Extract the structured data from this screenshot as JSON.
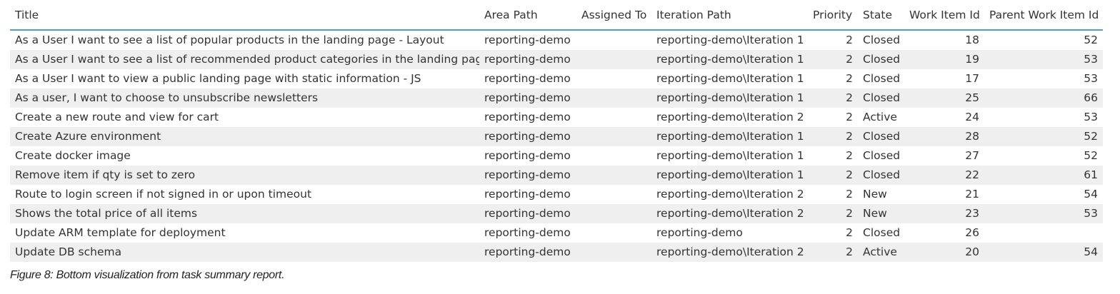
{
  "table": {
    "columns": [
      "Title",
      "Area Path",
      "Assigned To",
      "Iteration Path",
      "Priority",
      "State",
      "Work Item Id",
      "Parent Work Item Id"
    ],
    "rows": [
      [
        "As a User I want to see a list of popular products in the landing page - Layout",
        "reporting-demo",
        "",
        "reporting-demo\\Iteration 1",
        "2",
        "Closed",
        "18",
        "52"
      ],
      [
        "As a User I want to see a list of recommended product categories in the landing page",
        "reporting-demo",
        "",
        "reporting-demo\\Iteration 1",
        "2",
        "Closed",
        "19",
        "53"
      ],
      [
        "As a User I want to view a public landing page with static information - JS",
        "reporting-demo",
        "",
        "reporting-demo\\Iteration 1",
        "2",
        "Closed",
        "17",
        "53"
      ],
      [
        "As a user, I want to choose to unsubscribe newsletters",
        "reporting-demo",
        "",
        "reporting-demo\\Iteration 1",
        "2",
        "Closed",
        "25",
        "66"
      ],
      [
        "Create a new route and view for cart",
        "reporting-demo",
        "",
        "reporting-demo\\Iteration 2",
        "2",
        "Active",
        "24",
        "53"
      ],
      [
        "Create Azure environment",
        "reporting-demo",
        "",
        "reporting-demo\\Iteration 1",
        "2",
        "Closed",
        "28",
        "52"
      ],
      [
        "Create docker image",
        "reporting-demo",
        "",
        "reporting-demo\\Iteration 1",
        "2",
        "Closed",
        "27",
        "52"
      ],
      [
        "Remove item if qty is set to zero",
        "reporting-demo",
        "",
        "reporting-demo\\Iteration 1",
        "2",
        "Closed",
        "22",
        "61"
      ],
      [
        "Route to login screen if not signed in or upon timeout",
        "reporting-demo",
        "",
        "reporting-demo\\Iteration 2",
        "2",
        "New",
        "21",
        "54"
      ],
      [
        "Shows the total price of all items",
        "reporting-demo",
        "",
        "reporting-demo\\Iteration 2",
        "2",
        "New",
        "23",
        "53"
      ],
      [
        "Update ARM template for deployment",
        "reporting-demo",
        "",
        "reporting-demo",
        "2",
        "Closed",
        "26",
        ""
      ],
      [
        "Update DB schema",
        "reporting-demo",
        "",
        "reporting-demo\\Iteration 2",
        "2",
        "Active",
        "20",
        "54"
      ]
    ]
  },
  "caption": "Figure 8: Bottom visualization from task summary report.",
  "colors": {
    "header_underline": "#4a9fd6",
    "row_alt": "#efefef"
  }
}
